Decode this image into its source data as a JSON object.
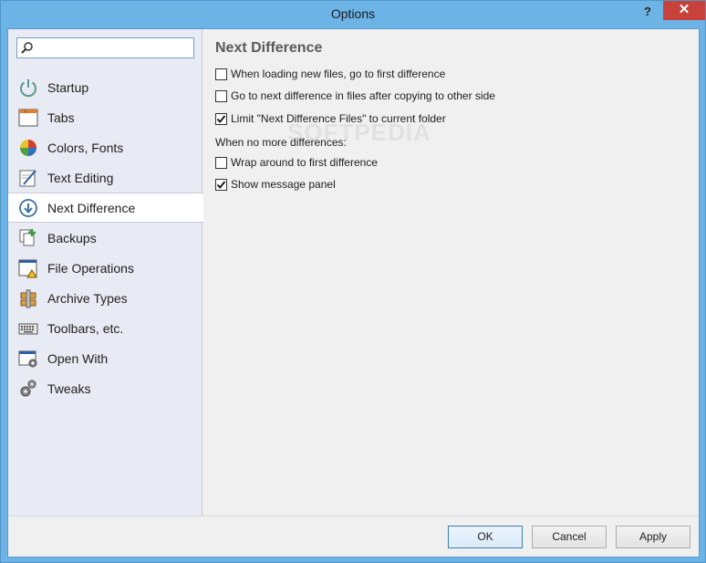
{
  "window": {
    "title": "Options",
    "help_label": "?",
    "close_label": "✕"
  },
  "search": {
    "placeholder": "",
    "value": ""
  },
  "sidebar": {
    "items": [
      {
        "label": "Startup",
        "icon": "power-icon",
        "active": false
      },
      {
        "label": "Tabs",
        "icon": "tabs-icon",
        "active": false
      },
      {
        "label": "Colors, Fonts",
        "icon": "palette-icon",
        "active": false
      },
      {
        "label": "Text Editing",
        "icon": "edit-document-icon",
        "active": false
      },
      {
        "label": "Next Difference",
        "icon": "down-arrow-circle-icon",
        "active": true
      },
      {
        "label": "Backups",
        "icon": "backup-icon",
        "active": false
      },
      {
        "label": "File Operations",
        "icon": "file-warning-icon",
        "active": false
      },
      {
        "label": "Archive Types",
        "icon": "archive-icon",
        "active": false
      },
      {
        "label": "Toolbars, etc.",
        "icon": "keyboard-icon",
        "active": false
      },
      {
        "label": "Open With",
        "icon": "window-gear-icon",
        "active": false
      },
      {
        "label": "Tweaks",
        "icon": "gears-icon",
        "active": false
      }
    ]
  },
  "content": {
    "title": "Next Difference",
    "options": [
      {
        "label": "When loading new files, go to first difference",
        "checked": false
      },
      {
        "label": "Go to next difference in files after copying to other side",
        "checked": false
      },
      {
        "label": "Limit \"Next Difference Files\" to current folder",
        "checked": true
      }
    ],
    "group_label": "When no more differences:",
    "group_options": [
      {
        "label": "Wrap around to first difference",
        "checked": false
      },
      {
        "label": "Show message panel",
        "checked": true
      }
    ],
    "watermark": "SOFTPEDIA"
  },
  "footer": {
    "ok_label": "OK",
    "cancel_label": "Cancel",
    "apply_label": "Apply"
  },
  "colors": {
    "titlebar": "#6db4e6",
    "close": "#c7423a",
    "sidebar": "#e8ebf3",
    "accent": "#3c7fb1"
  }
}
